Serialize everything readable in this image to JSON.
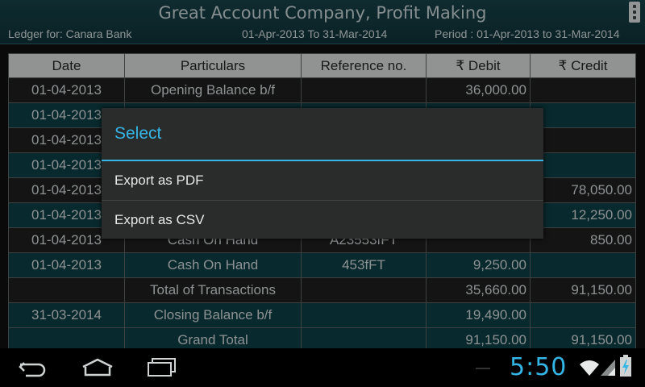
{
  "header": {
    "title": "Great Account Company, Profit Making",
    "ledger": "Ledger for: Canara Bank",
    "date_range": "01-Apr-2013 To 31-Mar-2014",
    "period": "Period : 01-Apr-2013 to 31-Mar-2014"
  },
  "table": {
    "columns": [
      "Date",
      "Particulars",
      "Reference no.",
      "₹ Debit",
      "₹ Credit"
    ],
    "rows": [
      {
        "date": "01-04-2013",
        "particulars": "Opening Balance b/f",
        "ref": "",
        "debit": "36,000.00",
        "credit": ""
      },
      {
        "date": "01-04-2013",
        "particulars": "",
        "ref": "",
        "debit": "",
        "credit": ""
      },
      {
        "date": "01-04-2013",
        "particulars": "",
        "ref": "",
        "debit": "",
        "credit": ""
      },
      {
        "date": "01-04-2013",
        "particulars": "",
        "ref": "",
        "debit": "",
        "credit": ""
      },
      {
        "date": "01-04-2013",
        "particulars": "",
        "ref": "",
        "debit": "",
        "credit": "78,050.00"
      },
      {
        "date": "01-04-2013",
        "particulars": "",
        "ref": "",
        "debit": "",
        "credit": "12,250.00"
      },
      {
        "date": "01-04-2013",
        "particulars": "Cash On Hand",
        "ref": "A23553fFT",
        "debit": "",
        "credit": "850.00"
      },
      {
        "date": "01-04-2013",
        "particulars": "Cash On Hand",
        "ref": "453fFT",
        "debit": "9,250.00",
        "credit": ""
      },
      {
        "date": "",
        "particulars": "Total of Transactions",
        "ref": "",
        "debit": "35,660.00",
        "credit": "91,150.00"
      },
      {
        "date": "31-03-2014",
        "particulars": "Closing Balance b/f",
        "ref": "",
        "debit": "19,490.00",
        "credit": ""
      },
      {
        "date": "",
        "particulars": "Grand Total",
        "ref": "",
        "debit": "91,150.00",
        "credit": "91,150.00"
      }
    ]
  },
  "dialog": {
    "title": "Select",
    "items": [
      "Export as PDF",
      "Export as CSV"
    ]
  },
  "status": {
    "time": "5:50"
  },
  "colors": {
    "accent": "#33b5e5",
    "header_bg": "#153d43",
    "row_teal": "#0c393f",
    "row_dark": "#1c1d1d"
  },
  "icons": [
    "back-icon",
    "home-icon",
    "recent-apps-icon",
    "wifi-icon",
    "signal-icon",
    "battery-charging-icon",
    "overflow-menu-icon"
  ]
}
